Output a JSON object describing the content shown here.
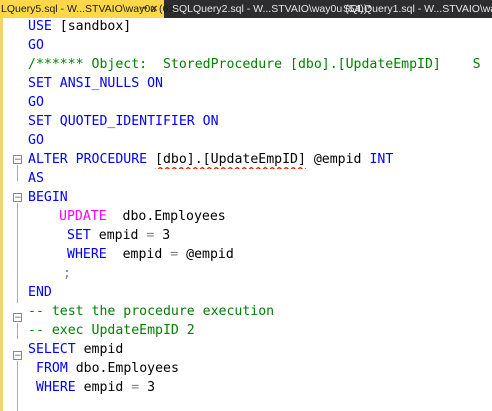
{
  "tabs": [
    {
      "label": "LQuery5.sql - W...STVAIO\\way0u (62))",
      "active": true,
      "pin_glyph": "⊸",
      "close_glyph": "×"
    },
    {
      "label": "SQLQuery2.sql - W...STVAIO\\way0u (54))*",
      "active": false
    },
    {
      "label": "SQLQuery1.sql - W...STVAIO\\way0u (5",
      "active": false
    }
  ],
  "code": {
    "l1": {
      "kw": "USE",
      "text": " [sandbox]"
    },
    "l2": {
      "kw": "GO"
    },
    "l3": {
      "comment": "/****** Object:  StoredProcedure [dbo].[UpdateEmpID]    S"
    },
    "l4": {
      "kw1": "SET",
      "kw2": " ANSI_NULLS ON"
    },
    "l5": {
      "kw": "GO"
    },
    "l6": {
      "kw1": "SET",
      "kw2": " QUOTED_IDENTIFIER ON"
    },
    "l7": {
      "kw": "GO"
    },
    "l8": {
      "kw": "ALTER PROCEDURE",
      "obj": "[dbo].[UpdateEmpID]",
      "param": " @empid ",
      "type": "INT"
    },
    "l9": {
      "kw": "AS"
    },
    "l10": {
      "kw": "BEGIN"
    },
    "l11": {
      "fn": "UPDATE",
      "text": "  dbo.Employees"
    },
    "l12": {
      "kw": "SET",
      "text": " empid ",
      "op": "=",
      "num": " 3"
    },
    "l13": {
      "kw": "WHERE",
      "text": "  empid ",
      "op": "=",
      "param": " @empid"
    },
    "l14": {
      "op": ";"
    },
    "l15": {
      "kw": "END"
    },
    "l16": {
      "comment": "-- test the procedure execution"
    },
    "l17": {
      "comment": "-- exec UpdateEmpID 2"
    },
    "l18": {
      "kw": "SELECT",
      "text": " empid"
    },
    "l19": {
      "kw": "FROM",
      "text": " dbo.Employees"
    },
    "l20": {
      "kw": "WHERE",
      "text": " empid ",
      "op": "=",
      "num": " 3"
    }
  },
  "colors": {
    "keyword": "#0000ff",
    "function": "#ff00ff",
    "comment": "#008000",
    "operator": "#808080",
    "active_tab": "#ffd84a",
    "tab_bar": "#2d2d30"
  }
}
